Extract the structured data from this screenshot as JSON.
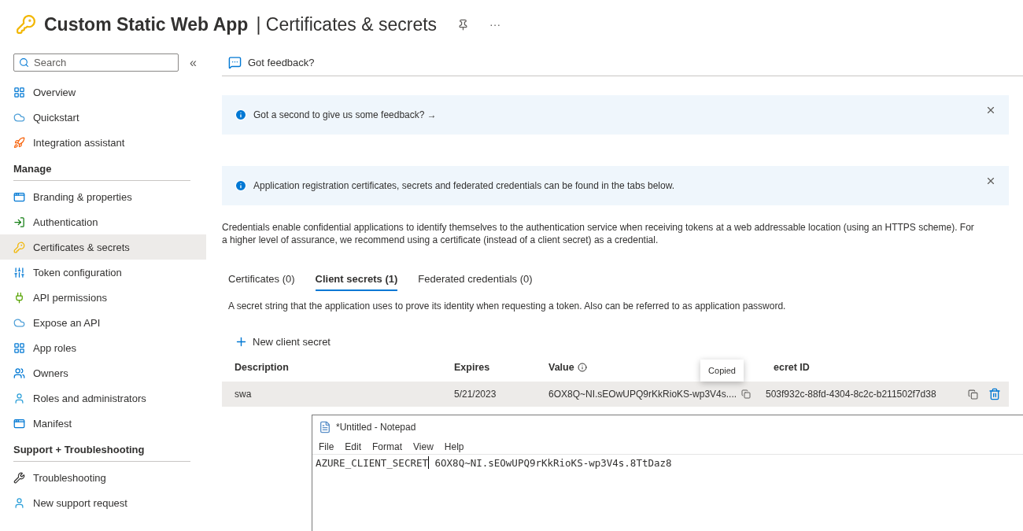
{
  "header": {
    "app_name": "Custom Static Web App",
    "separator": "|",
    "page_title": "Certificates & secrets",
    "more": "···"
  },
  "sidebar": {
    "search": {
      "placeholder": "Search"
    },
    "collapse": "«",
    "sections": [
      {
        "items": [
          {
            "label": "Overview",
            "selected": false
          },
          {
            "label": "Quickstart",
            "selected": false
          },
          {
            "label": "Integration assistant",
            "selected": false
          }
        ]
      },
      {
        "heading": "Manage",
        "items": [
          {
            "label": "Branding & properties",
            "selected": false
          },
          {
            "label": "Authentication",
            "selected": false
          },
          {
            "label": "Certificates & secrets",
            "selected": true
          },
          {
            "label": "Token configuration",
            "selected": false
          },
          {
            "label": "API permissions",
            "selected": false
          },
          {
            "label": "Expose an API",
            "selected": false
          },
          {
            "label": "App roles",
            "selected": false
          },
          {
            "label": "Owners",
            "selected": false
          },
          {
            "label": "Roles and administrators",
            "selected": false
          },
          {
            "label": "Manifest",
            "selected": false
          }
        ]
      },
      {
        "heading": "Support + Troubleshooting",
        "items": [
          {
            "label": "Troubleshooting",
            "selected": false
          },
          {
            "label": "New support request",
            "selected": false
          }
        ]
      }
    ]
  },
  "toolbar": {
    "feedback": "Got feedback?"
  },
  "banners": [
    {
      "text": "Got a second to give us some feedback? →"
    },
    {
      "text": "Application registration certificates, secrets and federated credentials can be found in the tabs below."
    }
  ],
  "description": "Credentials enable confidential applications to identify themselves to the authentication service when receiving tokens at a web addressable location (using an HTTPS scheme). For a higher level of assurance, we recommend using a certificate (instead of a client secret) as a credential.",
  "tabs": [
    {
      "label": "Certificates (0)",
      "selected": false
    },
    {
      "label": "Client secrets (1)",
      "selected": true
    },
    {
      "label": "Federated credentials (0)",
      "selected": false
    }
  ],
  "tab_description": "A secret string that the application uses to prove its identity when requesting a token. Also can be referred to as application password.",
  "new_button": "New client secret",
  "table": {
    "columns": [
      "Description",
      "Expires",
      "Value",
      "ecret ID"
    ],
    "rows": [
      {
        "description": "swa",
        "expires": "5/21/2023",
        "value": "6OX8Q~NI.sEOwUPQ9rKkRioKS-wp3V4s....",
        "secret_id": "503f932c-88fd-4304-8c2c-b211502f7d38"
      }
    ]
  },
  "tooltip": "Copied",
  "notepad": {
    "title": "*Untitled - Notepad",
    "menu": [
      "File",
      "Edit",
      "Format",
      "View",
      "Help"
    ],
    "line_key": "AZURE_CLIENT_SECRET",
    "line_value": " 6OX8Q~NI.sEOwUPQ9rKkRioKS-wp3V4s.8TtDaz8"
  }
}
